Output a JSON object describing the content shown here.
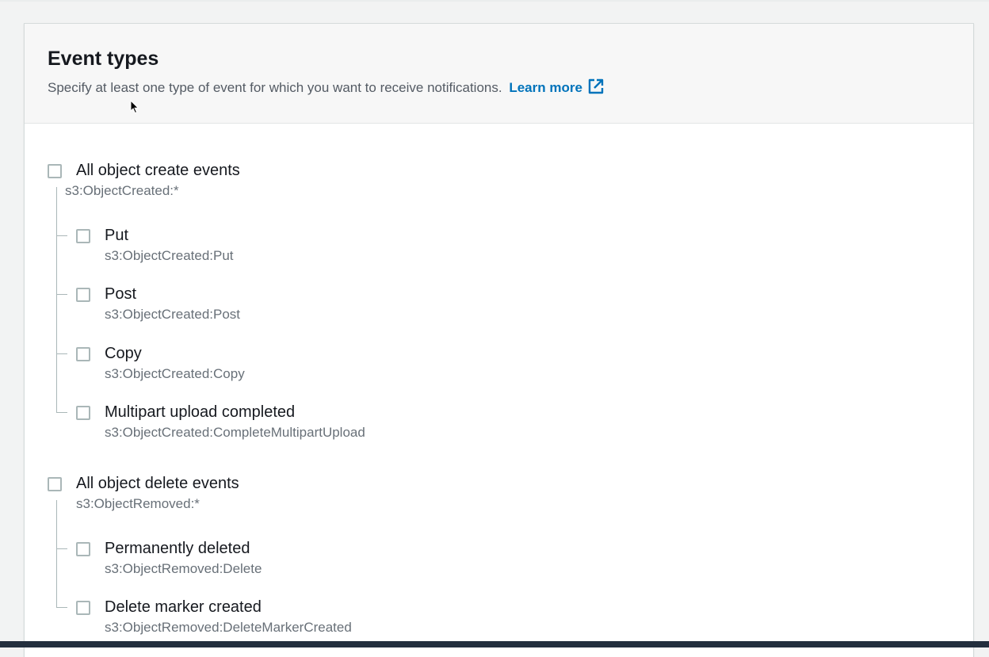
{
  "section": {
    "title": "Event types",
    "description": "Specify at least one type of event for which you want to receive notifications.",
    "learn_more": "Learn more",
    "learn_more_icon": "external-link-icon"
  },
  "groups": [
    {
      "label": "All object create events",
      "event": "s3:ObjectCreated:*",
      "checked": false,
      "items": [
        {
          "label": "Put",
          "event": "s3:ObjectCreated:Put",
          "checked": false
        },
        {
          "label": "Post",
          "event": "s3:ObjectCreated:Post",
          "checked": false
        },
        {
          "label": "Copy",
          "event": "s3:ObjectCreated:Copy",
          "checked": false
        },
        {
          "label": "Multipart upload completed",
          "event": "s3:ObjectCreated:CompleteMultipartUpload",
          "checked": false
        }
      ]
    },
    {
      "label": "All object delete events",
      "event": "s3:ObjectRemoved:*",
      "checked": false,
      "items": [
        {
          "label": "Permanently deleted",
          "event": "s3:ObjectRemoved:Delete",
          "checked": false
        },
        {
          "label": "Delete marker created",
          "event": "s3:ObjectRemoved:DeleteMarkerCreated",
          "checked": false
        }
      ]
    }
  ],
  "colors": {
    "link": "#0073bb",
    "checkbox_border": "#aab7b8",
    "secondary_text": "#687078"
  }
}
